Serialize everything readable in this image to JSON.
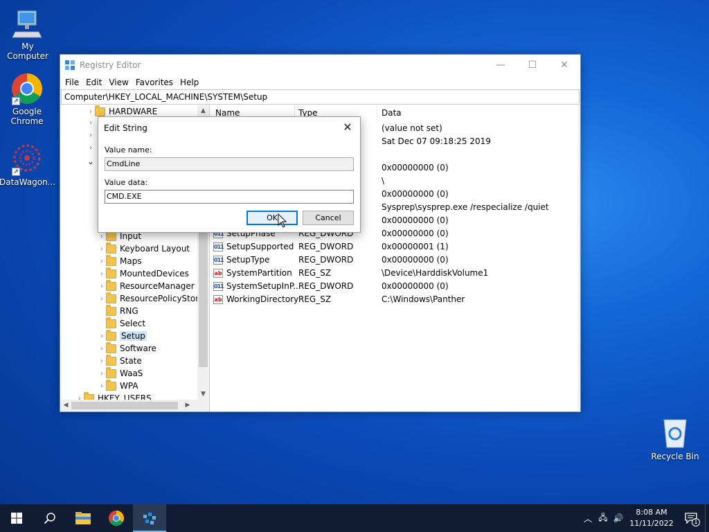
{
  "desktop": {
    "icons": [
      {
        "label": "My Computer"
      },
      {
        "label": "Google Chrome"
      },
      {
        "label": "DataWagon..."
      },
      {
        "label": "Recycle Bin"
      }
    ]
  },
  "window": {
    "title": "Registry Editor",
    "controls": {
      "minimize": "—",
      "maximize": "☐",
      "close": "✕"
    },
    "menu": [
      "File",
      "Edit",
      "View",
      "Favorites",
      "Help"
    ],
    "address": "Computer\\HKEY_LOCAL_MACHINE\\SYSTEM\\Setup",
    "tree": {
      "top_items": [
        {
          "label": "HARDWARE",
          "chev": "›"
        }
      ],
      "hidden_chevrons": [
        "›",
        "›",
        "›",
        "⌄"
      ],
      "items": [
        {
          "label": "Input",
          "chev": "›"
        },
        {
          "label": "Keyboard Layout",
          "chev": "›"
        },
        {
          "label": "Maps",
          "chev": "›"
        },
        {
          "label": "MountedDevices",
          "chev": "›"
        },
        {
          "label": "ResourceManager",
          "chev": "›"
        },
        {
          "label": "ResourcePolicyStore",
          "chev": "›"
        },
        {
          "label": "RNG",
          "chev": ""
        },
        {
          "label": "Select",
          "chev": ""
        },
        {
          "label": "Setup",
          "chev": "›"
        },
        {
          "label": "Software",
          "chev": "›"
        },
        {
          "label": "State",
          "chev": "›"
        },
        {
          "label": "WaaS",
          "chev": "›"
        },
        {
          "label": "WPA",
          "chev": "›"
        }
      ],
      "bottom_item": {
        "label": "HKEY_USERS",
        "chev": "›"
      }
    },
    "list": {
      "columns": {
        "name": "Name",
        "type": "Type",
        "data": "Data"
      },
      "rows": [
        {
          "name": "",
          "type": "",
          "data": "(value not set)",
          "kind": "sz"
        },
        {
          "name": "",
          "type": "",
          "data": "Sat Dec 07 09:18:25 2019",
          "kind": "sz"
        },
        {
          "name": "",
          "type": "",
          "data": "",
          "kind": "sz"
        },
        {
          "name": "",
          "type": "",
          "data": "0x00000000 (0)",
          "kind": "dw"
        },
        {
          "name": "",
          "type": "",
          "data": "\\",
          "kind": "sz"
        },
        {
          "name": "",
          "type": "",
          "data": "0x00000000 (0)",
          "kind": "dw"
        },
        {
          "name": "",
          "type": "",
          "data": "Sysprep\\sysprep.exe /respecialize /quiet",
          "kind": "sz"
        },
        {
          "name": "",
          "type": "",
          "data": "0x00000000 (0)",
          "kind": "dw"
        },
        {
          "name": "SetupPhase",
          "type": "REG_DWORD",
          "data": "0x00000000 (0)",
          "kind": "dw"
        },
        {
          "name": "SetupSupported",
          "type": "REG_DWORD",
          "data": "0x00000001 (1)",
          "kind": "dw"
        },
        {
          "name": "SetupType",
          "type": "REG_DWORD",
          "data": "0x00000000 (0)",
          "kind": "dw"
        },
        {
          "name": "SystemPartition",
          "type": "REG_SZ",
          "data": "\\Device\\HarddiskVolume1",
          "kind": "sz"
        },
        {
          "name": "SystemSetupInP...",
          "type": "REG_DWORD",
          "data": "0x00000000 (0)",
          "kind": "dw"
        },
        {
          "name": "WorkingDirectory",
          "type": "REG_SZ",
          "data": "C:\\Windows\\Panther",
          "kind": "sz"
        }
      ]
    }
  },
  "dialog": {
    "title": "Edit String",
    "close": "✕",
    "value_name_label": "Value name:",
    "value_name": "CmdLine",
    "value_data_label": "Value data:",
    "value_data": "CMD.EXE",
    "ok": "OK",
    "cancel": "Cancel"
  },
  "taskbar": {
    "clock_time": "8:08 AM",
    "clock_date": "11/11/2022",
    "notification_count": "1"
  }
}
